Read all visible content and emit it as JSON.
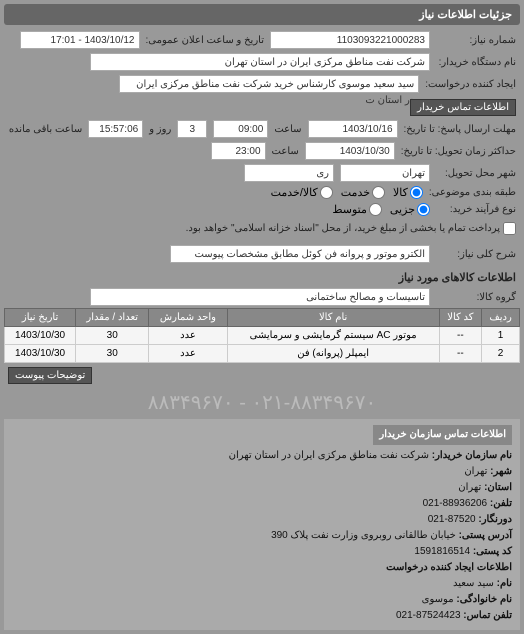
{
  "header": {
    "title": "جزئیات اطلاعات نیاز"
  },
  "form": {
    "req_no_label": "شماره نیاز:",
    "req_no": "1103093221000283",
    "announce_label": "تاریخ و ساعت اعلان عمومی:",
    "announce_value": "1403/10/12 - 17:01",
    "buyer_dev_label": "نام دستگاه خریدار:",
    "buyer_dev": "شرکت نفت مناطق مرکزی ایران در استان تهران",
    "creator_label": "ایجاد کننده درخواست:",
    "creator": "سید سعید موسوی کارشناس خرید شرکت نفت مناطق مرکزی ایران در استان ت",
    "buyer_contact_btn": "اطلاعات تماس خریدار",
    "deadline_send_label": "مهلت ارسال پاسخ: تا تاریخ:",
    "deadline_date": "1403/10/16",
    "time_label": "ساعت",
    "deadline_time": "09:00",
    "days_label": "روز و",
    "days_value": "3",
    "remaining_label": "ساعت باقی مانده",
    "remaining_time": "15:57:06",
    "delivery_label": "حداکثر زمان تحویل: تا تاریخ:",
    "delivery_date": "1403/10/30",
    "delivery_time": "23:00",
    "city_label": "شهر محل تحویل:",
    "city_province": "تهران",
    "city_name": "ری",
    "pkg_type_label": "طبقه بندی موضوعی:",
    "pkg_kala": "کالا",
    "pkg_khedmat": "خدمت",
    "pkg_kala_khedmat": "کالا/خدمت",
    "process_type_label": "نوع فرآیند خرید:",
    "proc_jozi": "جزیی",
    "proc_motavaset": "متوسط",
    "proc_note": "پرداخت تمام یا بخشی از مبلغ خرید، از محل \"اسناد خزانه اسلامی\" خواهد بود.",
    "desc_label": "شرح کلی نیاز:",
    "desc_value": "الکترو موتور و پروانه فن کوئل مطابق مشخصات پیوست"
  },
  "goods": {
    "section_title": "اطلاعات کالاهای مورد نیاز",
    "group_label": "گروه کالا:",
    "group_value": "تاسیسات و مصالح ساختمانی",
    "cols": {
      "row": "ردیف",
      "code": "کد کالا",
      "name": "نام کالا",
      "unit": "واحد شمارش",
      "qty": "تعداد / مقدار",
      "date": "تاریخ نیاز"
    },
    "rows": [
      {
        "row": "1",
        "code": "--",
        "name": "موتور AC سیستم گرمایشی و سرمایشی",
        "unit": "عدد",
        "qty": "30",
        "date": "1403/10/30"
      },
      {
        "row": "2",
        "code": "--",
        "name": "ایمپلر (پروانه) فن",
        "unit": "عدد",
        "qty": "30",
        "date": "1403/10/30"
      }
    ],
    "attach_btn": "توضیحات پیوست"
  },
  "watermark": "۰۲۱-۸۸۳۴۹۶۷۰ - ۸۸۳۴۹۶۷۰",
  "buyer_info": {
    "header": "اطلاعات تماس سازمان خریدار",
    "f1_l": "نام سازمان خریدار:",
    "f1_v": "شرکت نفت مناطق مرکزی ایران در استان تهران",
    "f2_l": "شهر:",
    "f2_v": "تهران",
    "f3_l": "استان:",
    "f3_v": "تهران",
    "f4_l": "تلفن:",
    "f4_v": "88936206-021",
    "f5_l": "دورنگار:",
    "f5_v": "87520-021",
    "f6_l": "آدرس پستی:",
    "f6_v": "خیابان طالقانی روبروی وزارت نفت پلاک 390",
    "f7_l": "کد پستی:",
    "f7_v": "1591816514",
    "f8_h": "اطلاعات ایجاد کننده درخواست",
    "f9_l": "نام:",
    "f9_v": "سید سعید",
    "f10_l": "نام خانوادگی:",
    "f10_v": "موسوی",
    "f11_l": "تلفن تماس:",
    "f11_v": "87524423-021"
  }
}
